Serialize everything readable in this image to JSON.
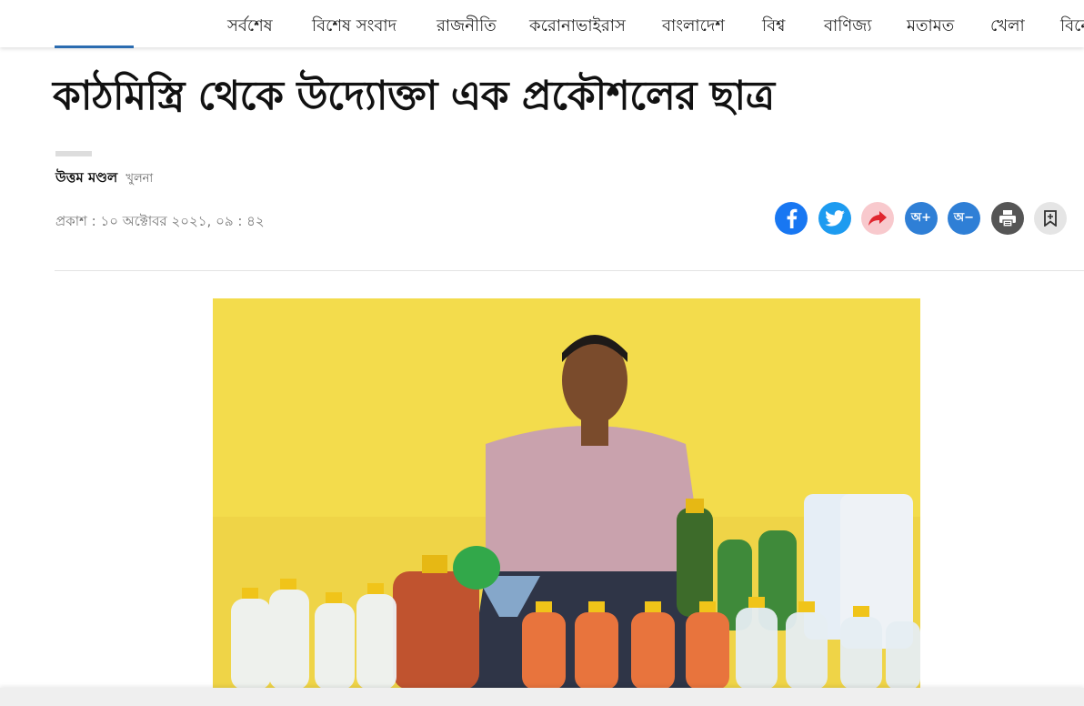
{
  "nav": {
    "items": [
      "সর্বশেষ",
      "বিশেষ সংবাদ",
      "রাজনীতি",
      "করোনাভাইরাস",
      "বাংলাদেশ",
      "বিশ্ব",
      "বাণিজ্য",
      "মতামত",
      "খেলা",
      "বিনো"
    ]
  },
  "article": {
    "headline": "কাঠমিস্ত্রি থেকে উদ্যোক্তা এক প্রকৌশলের ছাত্র",
    "author": "উত্তম মণ্ডল",
    "location": "খুলনা",
    "published": "প্রকাশ : ১০ অক্টোবর ২০২১, ০৯ : ৪২"
  },
  "share": {
    "font_increase": "অ+",
    "font_decrease": "অ−"
  },
  "colors": {
    "facebook": "#1877f2",
    "twitter": "#1d9bf0",
    "share": "#f8c9cd",
    "font_buttons": "#2f7fd6",
    "print": "#555555",
    "bookmark": "#e5e5e5",
    "accent": "#2b6cb0"
  },
  "icons": [
    "facebook-icon",
    "twitter-icon",
    "share-arrow-icon",
    "print-icon",
    "bookmark-icon"
  ]
}
